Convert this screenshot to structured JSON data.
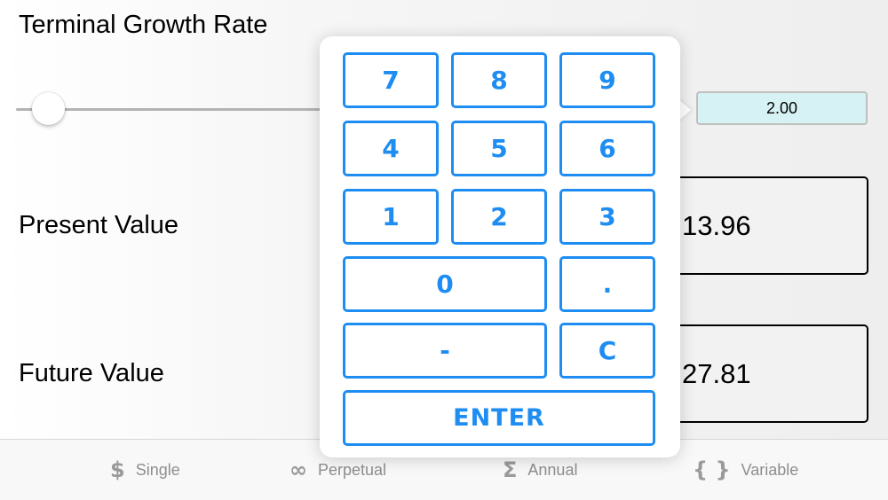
{
  "labels": {
    "terminal_growth_rate": "Terminal Growth Rate",
    "present_value": "Present Value",
    "future_value": "Future Value"
  },
  "slider": {
    "value_fraction": 0.1
  },
  "rate_value": "2.00",
  "present_value": "13.96",
  "future_value": "27.81",
  "keypad": {
    "k7": "7",
    "k8": "8",
    "k9": "9",
    "k4": "4",
    "k5": "5",
    "k6": "6",
    "k1": "1",
    "k2": "2",
    "k3": "3",
    "k0": "0",
    "kdot": ".",
    "kminus": "-",
    "kclear": "C",
    "enter": "ENTER"
  },
  "tabs": [
    {
      "label": "Single",
      "icon": "dollar-icon",
      "glyph": "$"
    },
    {
      "label": "Perpetual",
      "icon": "infinity-icon",
      "glyph": "∞"
    },
    {
      "label": "Annual",
      "icon": "sigma-icon",
      "glyph": "Σ"
    },
    {
      "label": "Variable",
      "icon": "braces-icon",
      "glyph": "{ }"
    }
  ],
  "colors": {
    "accent": "#1e8df2",
    "rate_box_bg": "#d7f2f4",
    "tab_inactive": "#8e8e8e"
  }
}
